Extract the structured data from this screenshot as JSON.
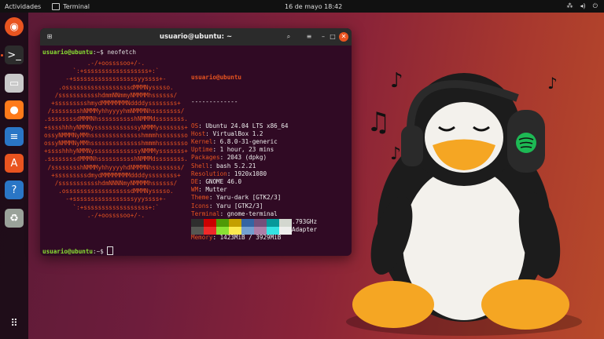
{
  "topbar": {
    "activities": "Actividades",
    "app": "Terminal",
    "clock": "16 de mayo  18:42"
  },
  "dock": [
    {
      "name": "ubuntu-icon",
      "glyph": "◉",
      "bg": "#e95420"
    },
    {
      "name": "terminal-icon",
      "glyph": ">_",
      "bg": "#2c2c2c"
    },
    {
      "name": "files-icon",
      "glyph": "▭",
      "bg": "#c9c9c9"
    },
    {
      "name": "firefox-icon",
      "glyph": "●",
      "bg": "#ff7a1a"
    },
    {
      "name": "writer-icon",
      "glyph": "≡",
      "bg": "#2a76c6"
    },
    {
      "name": "app-center-icon",
      "glyph": "A",
      "bg": "#e95420"
    },
    {
      "name": "help-icon",
      "glyph": "?",
      "bg": "#2a76c6"
    },
    {
      "name": "trash-icon",
      "glyph": "♻",
      "bg": "#9aa29a"
    },
    {
      "name": "apps-grid-icon",
      "glyph": "⠿",
      "bg": "transparent"
    }
  ],
  "terminal": {
    "title": "usuario@ubuntu: ~",
    "prompt_user": "usuario@ubuntu",
    "prompt_rest": ":~$ ",
    "command": "neofetch",
    "header": "usuario@ubuntu",
    "separator": "-------------",
    "info": [
      {
        "k": "OS",
        "v": "Ubuntu 24.04 LTS x86_64"
      },
      {
        "k": "Host",
        "v": "VirtualBox 1.2"
      },
      {
        "k": "Kernel",
        "v": "6.8.0-31-generic"
      },
      {
        "k": "Uptime",
        "v": "1 hour, 23 mins"
      },
      {
        "k": "Packages",
        "v": "2043 (dpkg)"
      },
      {
        "k": "Shell",
        "v": "bash 5.2.21"
      },
      {
        "k": "Resolution",
        "v": "1920x1080"
      },
      {
        "k": "DE",
        "v": "GNOME 46.0"
      },
      {
        "k": "WM",
        "v": "Mutter"
      },
      {
        "k": "Theme",
        "v": "Yaru-dark [GTK2/3]"
      },
      {
        "k": "Icons",
        "v": "Yaru [GTK2/3]"
      },
      {
        "k": "Terminal",
        "v": "gnome-terminal"
      },
      {
        "k": "CPU",
        "v": "Intel i7-10700K (2) @ 3.793GHz"
      },
      {
        "k": "GPU",
        "v": "00:02.0 VMware SVGA II Adapter"
      },
      {
        "k": "Memory",
        "v": "1423MiB / 3929MiB"
      }
    ],
    "logo": [
      "            .-/+oossssoo+/-.",
      "        `:+ssssssssssssssssss+:`",
      "      -+ssssssssssssssssssyyssss+-",
      "    .ossssssssssssssssssdMMMNysssso.",
      "   /ssssssssssshdmmNNmmyNMMMMhssssss/",
      "  +ssssssssshmydMMMMMMMNddddyssssssss+",
      " /sssssssshNMMMyhhyyyyhmNMMMNhssssssss/",
      ".ssssssssdMMMNhsssssssssshNMMMdssssssss.",
      "+sssshhhyNMMNyssssssssssssyNMMMysssssss+",
      "ossyNMMMNyMMhsssssssssssssshmmmhssssssso",
      "ossyNMMMNyMMhsssssssssssssshmmmhssssssso",
      "+sssshhhyNMMNyssssssssssssyNMMMysssssss+",
      ".ssssssssdMMMNhsssssssssshNMMMdssssssss.",
      " /sssssssshNMMMyhhyyyyhdNMMMNhssssssss/",
      "  +sssssssssdmydMMMMMMMMddddyssssssss+",
      "   /ssssssssssshdmNNNNmyNMMMMhssssss/",
      "    .ossssssssssssssssssdMMMNysssso.",
      "      -+sssssssssssssssssyyyssss+-",
      "        `:+ssssssssssssssssss+:`",
      "            .-/+oossssoo+/-."
    ],
    "palette": [
      "#2e2e2e",
      "#cc0000",
      "#4e9a06",
      "#c4a000",
      "#3465a4",
      "#75507b",
      "#06989a",
      "#d3d7cf",
      "#555753",
      "#ef2929",
      "#8ae234",
      "#fce94f",
      "#729fcf",
      "#ad7fa8",
      "#34e2e2",
      "#eeeeec"
    ]
  },
  "colors": {
    "accent": "#e95420",
    "term_bg": "#300a24",
    "prompt_green": "#8ae234"
  }
}
